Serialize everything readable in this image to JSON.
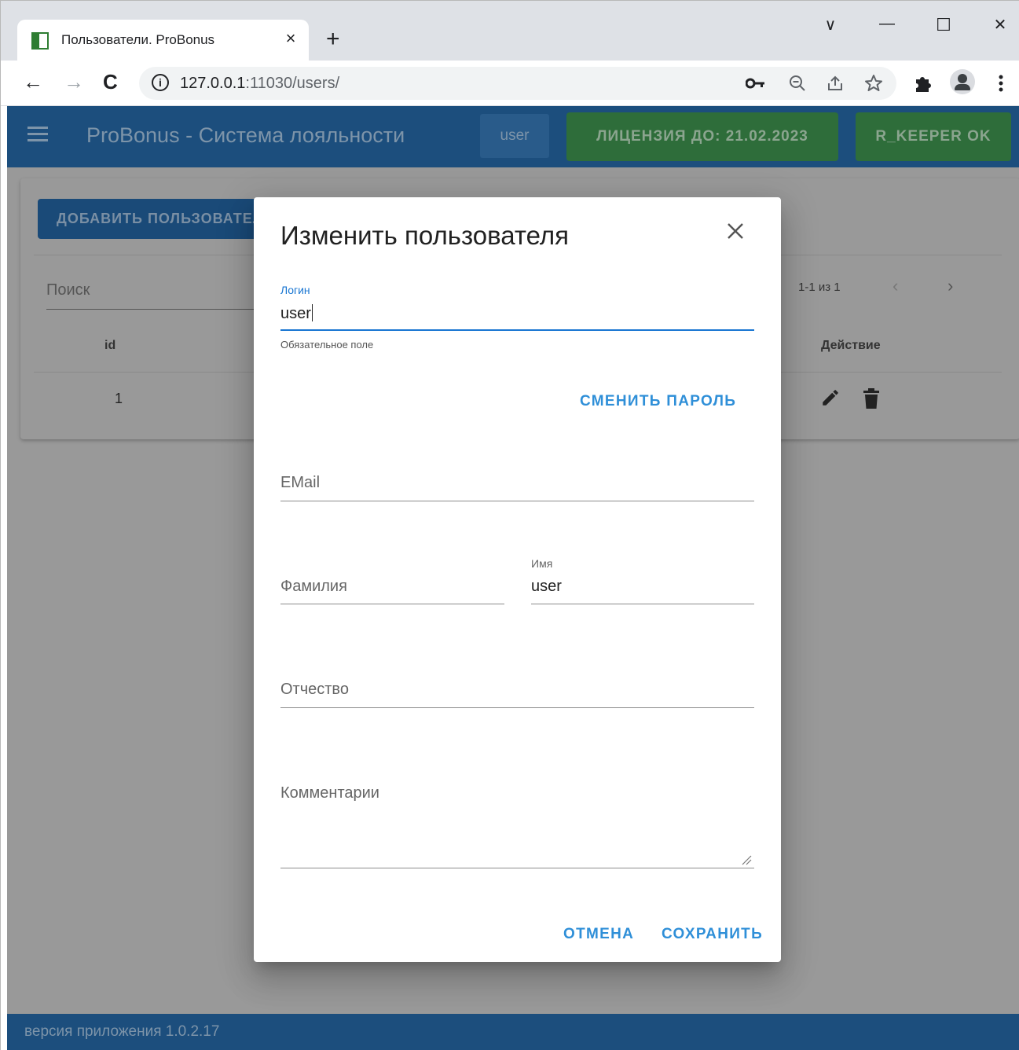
{
  "browser": {
    "tab_title": "Пользователи. ProBonus",
    "tab_close_glyph": "×",
    "new_tab_glyph": "+",
    "window_controls": {
      "tabsearch": "∨",
      "minimize": "—",
      "maximize": "☐",
      "close": "✕"
    },
    "nav": {
      "back": "←",
      "forward": "→",
      "reload": "C"
    },
    "url_host": "127.0.0.1",
    "url_rest": ":11030/users/",
    "icons": [
      "key-icon",
      "zoom-icon",
      "share-icon",
      "star-icon",
      "extensions-icon",
      "profile-icon",
      "menu-icon"
    ]
  },
  "app": {
    "title": "ProBonus - Система лояльности",
    "user": "user",
    "license_button": "ЛИЦЕНЗИЯ ДО: 21.02.2023",
    "rkeeper_button": "R_KEEPER OK",
    "add_user_button": "ДОБАВИТЬ ПОЛЬЗОВАТЕЛЯ",
    "search_placeholder": "Поиск",
    "pagination": "1-1 из 1",
    "table": {
      "headers": {
        "id": "id",
        "action": "Действие"
      },
      "rows": [
        {
          "id": "1"
        }
      ]
    },
    "footer": "версия приложения 1.0.2.17"
  },
  "dialog": {
    "title": "Изменить пользователя",
    "login_label": "Логин",
    "login_value": "user",
    "login_hint": "Обязательное поле",
    "change_password_button": "СМЕНИТЬ ПАРОЛЬ",
    "email_placeholder": "EMail",
    "lastname_placeholder": "Фамилия",
    "firstname_label": "Имя",
    "firstname_value": "user",
    "middlename_placeholder": "Отчество",
    "comments_placeholder": "Комментарии",
    "cancel_button": "ОТМЕНА",
    "save_button": "СОХРАНИТЬ"
  },
  "colors": {
    "appbar": "#1c4e7d",
    "accent_blue": "#1976d2",
    "link_blue": "#2f8fd8",
    "license_green": "#2e6d3a",
    "overlay_gray": "#999999"
  }
}
